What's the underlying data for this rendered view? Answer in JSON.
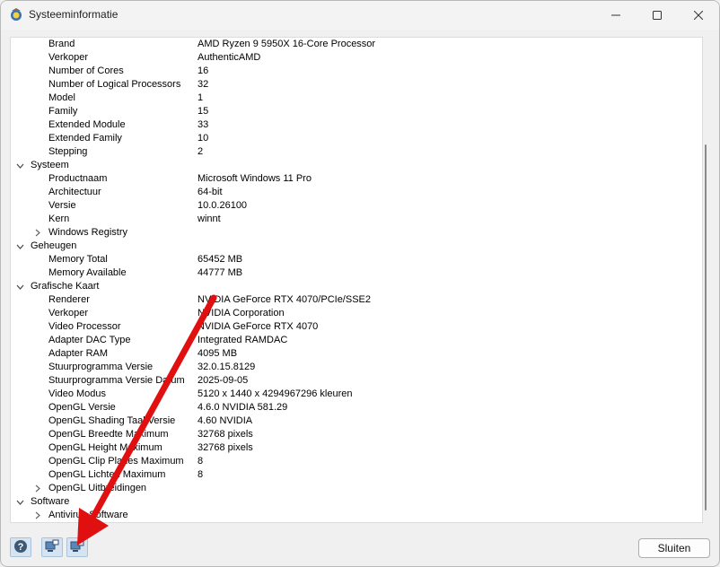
{
  "window": {
    "title": "Systeeminformatie",
    "icons": {
      "app": "sysinfo-app-icon",
      "minimize": "minimize-icon",
      "maximize": "maximize-icon",
      "close": "close-icon"
    }
  },
  "tree": [
    {
      "level": 1,
      "key": "Brand",
      "value": "AMD Ryzen 9 5950X 16-Core Processor"
    },
    {
      "level": 1,
      "key": "Verkoper",
      "value": "AuthenticAMD"
    },
    {
      "level": 1,
      "key": "Number of Cores",
      "value": "16"
    },
    {
      "level": 1,
      "key": "Number of Logical Processors",
      "value": "32"
    },
    {
      "level": 1,
      "key": "Model",
      "value": "1"
    },
    {
      "level": 1,
      "key": "Family",
      "value": "15"
    },
    {
      "level": 1,
      "key": "Extended Module",
      "value": "33"
    },
    {
      "level": 1,
      "key": "Extended Family",
      "value": "10"
    },
    {
      "level": 1,
      "key": "Stepping",
      "value": "2"
    },
    {
      "level": 0,
      "key": "Systeem",
      "value": "",
      "expander": "expanded"
    },
    {
      "level": 1,
      "key": "Productnaam",
      "value": "Microsoft Windows 11 Pro"
    },
    {
      "level": 1,
      "key": "Architectuur",
      "value": "64-bit"
    },
    {
      "level": 1,
      "key": "Versie",
      "value": "10.0.26100"
    },
    {
      "level": 1,
      "key": "Kern",
      "value": "winnt"
    },
    {
      "level": 1,
      "key": "Windows Registry",
      "value": "",
      "expander": "collapsed"
    },
    {
      "level": 0,
      "key": "Geheugen",
      "value": "",
      "expander": "expanded"
    },
    {
      "level": 1,
      "key": "Memory Total",
      "value": "65452 MB"
    },
    {
      "level": 1,
      "key": "Memory Available",
      "value": "44777 MB"
    },
    {
      "level": 0,
      "key": "Grafische Kaart",
      "value": "",
      "expander": "expanded"
    },
    {
      "level": 1,
      "key": "Renderer",
      "value": "NVIDIA GeForce RTX 4070/PCIe/SSE2"
    },
    {
      "level": 1,
      "key": "Verkoper",
      "value": "NVIDIA Corporation"
    },
    {
      "level": 1,
      "key": "Video Processor",
      "value": "NVIDIA GeForce RTX 4070"
    },
    {
      "level": 1,
      "key": "Adapter DAC Type",
      "value": "Integrated RAMDAC"
    },
    {
      "level": 1,
      "key": "Adapter RAM",
      "value": "4095 MB"
    },
    {
      "level": 1,
      "key": "Stuurprogramma Versie",
      "value": "32.0.15.8129"
    },
    {
      "level": 1,
      "key": "Stuurprogramma Versie Datum",
      "value": "2025-09-05"
    },
    {
      "level": 1,
      "key": "Video Modus",
      "value": "5120 x 1440 x 4294967296 kleuren"
    },
    {
      "level": 1,
      "key": "OpenGL Versie",
      "value": "4.6.0 NVIDIA 581.29"
    },
    {
      "level": 1,
      "key": "OpenGL Shading Taal Versie",
      "value": "4.60 NVIDIA"
    },
    {
      "level": 1,
      "key": "OpenGL Breedte Maximum",
      "value": "32768 pixels"
    },
    {
      "level": 1,
      "key": "OpenGL Height Maximum",
      "value": "32768 pixels"
    },
    {
      "level": 1,
      "key": "OpenGL Clip Planes Maximum",
      "value": "8"
    },
    {
      "level": 1,
      "key": "OpenGL Lichten Maximum",
      "value": "8"
    },
    {
      "level": 1,
      "key": "OpenGL Uitbreidingen",
      "value": "",
      "expander": "collapsed"
    },
    {
      "level": 0,
      "key": "Software",
      "value": "",
      "expander": "expanded"
    },
    {
      "level": 1,
      "key": "Antivirus Software",
      "value": "",
      "expander": "collapsed"
    }
  ],
  "toolbar": {
    "help_icon": "help-icon",
    "copy_icon": "computer-copy-icon",
    "save_icon": "computer-save-icon"
  },
  "close_button": {
    "label": "Sluiten"
  },
  "annotation": {
    "color": "#e01010",
    "icon": "red-arrow"
  }
}
